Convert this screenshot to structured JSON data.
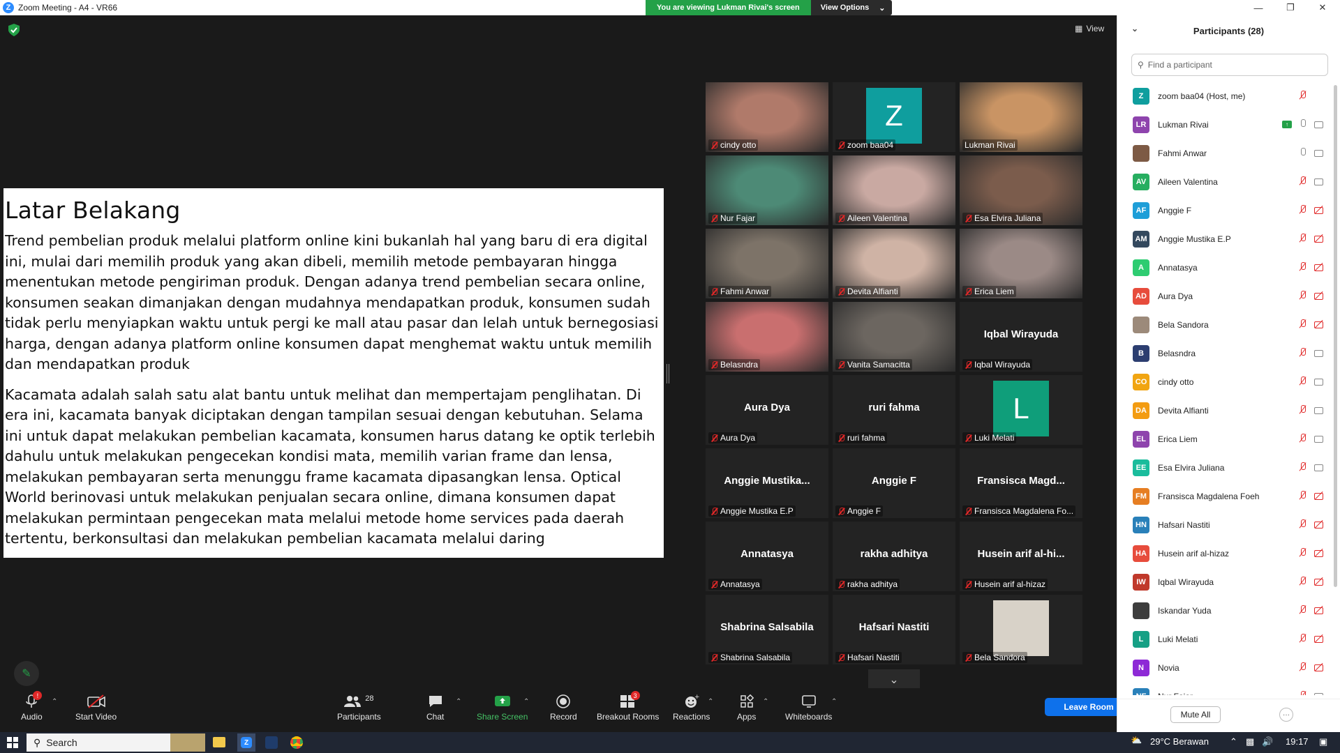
{
  "window": {
    "title": "Zoom Meeting - A4 - VR66",
    "viewing_banner": "You are viewing Lukman Rivai's screen",
    "view_options": "View Options",
    "view_label": "View"
  },
  "document": {
    "heading": "Latar Belakang",
    "paragraph1": "Trend pembelian produk melalui platform online kini bukanlah hal yang baru di era digital ini, mulai dari memilih produk yang akan dibeli, memilih metode pembayaran hingga menentukan metode pengiriman produk. Dengan adanya trend pembelian secara online, konsumen seakan dimanjakan dengan mudahnya mendapatkan produk, konsumen sudah tidak perlu menyiapkan waktu untuk pergi ke mall atau pasar dan lelah untuk bernegosiasi harga, dengan adanya platform online konsumen dapat menghemat waktu untuk memilih dan mendapatkan produk",
    "paragraph2": "Kacamata adalah salah satu alat bantu untuk melihat dan mempertajam penglihatan. Di era ini, kacamata banyak diciptakan dengan tampilan sesuai dengan kebutuhan. Selama ini untuk dapat melakukan pembelian kacamata, konsumen harus datang ke optik terlebih dahulu untuk melakukan pengecekan kondisi mata, memilih varian frame dan lensa, melakukan pembayaran serta menunggu frame kacamata dipasangkan lensa. Optical World berinovasi untuk melakukan penjualan secara online, dimana konsumen dapat melakukan permintaan pengecekan mata melalui metode home services pada daerah tertentu, berkonsultasi dan melakukan pembelian kacamata melalui daring"
  },
  "tiles": [
    {
      "name": "cindy otto",
      "center": "",
      "kind": "video",
      "color": "#b07a6a"
    },
    {
      "name": "zoom baa04",
      "center": "",
      "kind": "avatar",
      "letter": "Z",
      "color": "#0f9e9e"
    },
    {
      "name": "Lukman Rivai",
      "center": "",
      "kind": "video",
      "color": "#c99464",
      "active": true
    },
    {
      "name": "Nur Fajar",
      "center": "",
      "kind": "video",
      "color": "#4d8a76"
    },
    {
      "name": "Aileen Valentina",
      "center": "",
      "kind": "video",
      "color": "#c9a9a2"
    },
    {
      "name": "Esa Elvira Juliana",
      "center": "",
      "kind": "video",
      "color": "#7b5c4c"
    },
    {
      "name": "Fahmi Anwar",
      "center": "",
      "kind": "video",
      "color": "#7d7368"
    },
    {
      "name": "Devita Alfianti",
      "center": "",
      "kind": "video",
      "color": "#cfb3a5"
    },
    {
      "name": "Erica Liem",
      "center": "",
      "kind": "video",
      "color": "#9b8a86"
    },
    {
      "name": "Belasndra",
      "center": "",
      "kind": "video",
      "color": "#c96f6f"
    },
    {
      "name": "Vanita Samacitta",
      "center": "",
      "kind": "video",
      "color": "#6c6660"
    },
    {
      "name": "Iqbal Wirayuda",
      "center": "Iqbal Wirayuda",
      "kind": "text"
    },
    {
      "name": "Aura Dya",
      "center": "Aura Dya",
      "kind": "text"
    },
    {
      "name": "ruri fahma",
      "center": "ruri fahma",
      "kind": "text"
    },
    {
      "name": "Luki Melati",
      "center": "",
      "kind": "avatar",
      "letter": "L",
      "color": "#0f9e7a"
    },
    {
      "name": "Anggie Mustika E.P",
      "center": "Anggie  Mustika...",
      "kind": "text"
    },
    {
      "name": "Anggie F",
      "center": "Anggie F",
      "kind": "text"
    },
    {
      "name": "Fransisca Magdalena Fo...",
      "center": "Fransisca  Magd...",
      "kind": "text"
    },
    {
      "name": "Annatasya",
      "center": "Annatasya",
      "kind": "text"
    },
    {
      "name": "rakha adhitya",
      "center": "rakha adhitya",
      "kind": "text"
    },
    {
      "name": "Husein arif al-hizaz",
      "center": "Husein  arif  al-hi...",
      "kind": "text"
    },
    {
      "name": "Shabrina Salsabila",
      "center": "Shabrina Salsabila",
      "kind": "text"
    },
    {
      "name": "Hafsari Nastiti",
      "center": "Hafsari Nastiti",
      "kind": "text"
    },
    {
      "name": "Bela Sandora",
      "center": "",
      "kind": "photo",
      "color": "#d8d2c8"
    }
  ],
  "toolbar": {
    "audio": "Audio",
    "audio_badge": "!",
    "start_video": "Start Video",
    "participants_count": "28",
    "participants": "Participants",
    "chat": "Chat",
    "share_screen": "Share Screen",
    "record": "Record",
    "breakout_rooms": "Breakout Rooms",
    "breakout_badge": "3",
    "reactions": "Reactions",
    "apps": "Apps",
    "whiteboards": "Whiteboards",
    "leave_room": "Leave Room"
  },
  "panel": {
    "title": "Participants (28)",
    "search_placeholder": "Find a participant",
    "mute_all": "Mute All",
    "more": "···",
    "participants": [
      {
        "initials": "Z",
        "name": "zoom baa04 (Host, me)",
        "color": "#0f9e9e",
        "mic": "off",
        "cam": "none"
      },
      {
        "initials": "LR",
        "name": "Lukman Rivai",
        "color": "#8e44ad",
        "mic": "on",
        "cam": "on",
        "sharing": true
      },
      {
        "initials": "",
        "name": "Fahmi Anwar",
        "color": "#7d5a45",
        "mic": "on",
        "cam": "on",
        "photo": true
      },
      {
        "initials": "AV",
        "name": "Aileen Valentina",
        "color": "#27ae60",
        "mic": "off",
        "cam": "on"
      },
      {
        "initials": "AF",
        "name": "Anggie F",
        "color": "#1e9ed8",
        "mic": "off",
        "cam": "off"
      },
      {
        "initials": "AM",
        "name": "Anggie Mustika E.P",
        "color": "#34495e",
        "mic": "off",
        "cam": "off"
      },
      {
        "initials": "A",
        "name": "Annatasya",
        "color": "#2ecc71",
        "mic": "off",
        "cam": "off"
      },
      {
        "initials": "AD",
        "name": "Aura Dya",
        "color": "#e74c3c",
        "mic": "off",
        "cam": "off"
      },
      {
        "initials": "",
        "name": "Bela Sandora",
        "color": "#9c8a7a",
        "mic": "off",
        "cam": "off",
        "photo": true
      },
      {
        "initials": "B",
        "name": "Belasndra",
        "color": "#2c3e70",
        "mic": "off",
        "cam": "on"
      },
      {
        "initials": "CO",
        "name": "cindy otto",
        "color": "#f1a512",
        "mic": "off",
        "cam": "on"
      },
      {
        "initials": "DA",
        "name": "Devita Alfianti",
        "color": "#f39c12",
        "mic": "off",
        "cam": "on"
      },
      {
        "initials": "EL",
        "name": "Erica Liem",
        "color": "#8e44ad",
        "mic": "off",
        "cam": "on"
      },
      {
        "initials": "EE",
        "name": "Esa Elvira Juliana",
        "color": "#1abc9c",
        "mic": "off",
        "cam": "on"
      },
      {
        "initials": "FM",
        "name": "Fransisca Magdalena Foeh",
        "color": "#e67e22",
        "mic": "off",
        "cam": "off"
      },
      {
        "initials": "HN",
        "name": "Hafsari Nastiti",
        "color": "#2980b9",
        "mic": "off",
        "cam": "off"
      },
      {
        "initials": "HA",
        "name": "Husein arif al-hizaz",
        "color": "#e74c3c",
        "mic": "off",
        "cam": "off"
      },
      {
        "initials": "IW",
        "name": "Iqbal Wirayuda",
        "color": "#c0392b",
        "mic": "off",
        "cam": "off"
      },
      {
        "initials": "",
        "name": "Iskandar Yuda",
        "color": "#3d3d3d",
        "mic": "off",
        "cam": "off",
        "photo": true
      },
      {
        "initials": "L",
        "name": "Luki Melati",
        "color": "#16a085",
        "mic": "off",
        "cam": "off"
      },
      {
        "initials": "N",
        "name": "Novia",
        "color": "#8e2ad6",
        "mic": "off",
        "cam": "off"
      },
      {
        "initials": "NF",
        "name": "Nur Fajar",
        "color": "#2980b9",
        "mic": "off",
        "cam": "on"
      }
    ]
  },
  "taskbar": {
    "search": "Search",
    "weather": "29°C  Berawan",
    "time": "19:17"
  },
  "colors": {
    "zoom_blue": "#0e71eb",
    "share_green": "#24a148",
    "muted_red": "#e02828",
    "active_speaker": "#d8e14a"
  }
}
